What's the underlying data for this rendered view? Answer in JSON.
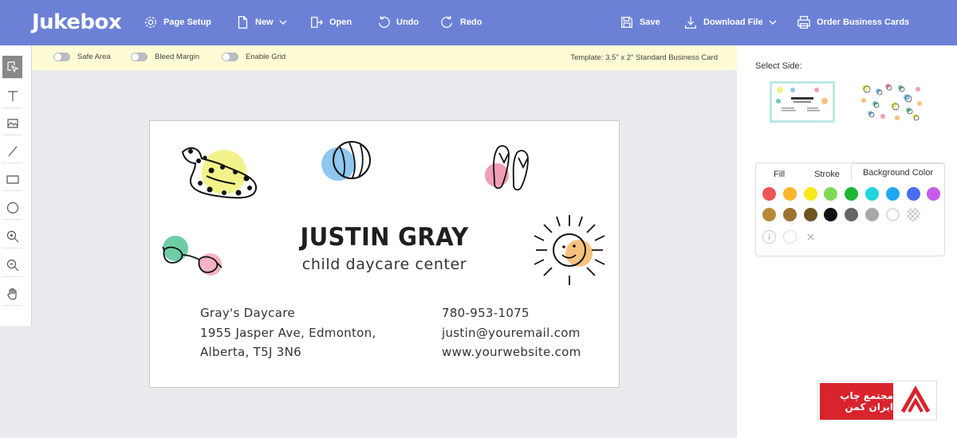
{
  "app": {
    "logo": "Jukebox"
  },
  "toolbar": {
    "page_setup": "Page Setup",
    "new": "New",
    "open": "Open",
    "undo": "Undo",
    "redo": "Redo",
    "save": "Save",
    "download": "Download File",
    "order": "Order Business Cards"
  },
  "subbar": {
    "safe_area": "Safe Area",
    "bleed_margin": "Bleed Margin",
    "enable_grid": "Enable Grid",
    "template": "Template: 3.5\" x 2\" Standard Business Card"
  },
  "tools": [
    "select-tool",
    "text-tool",
    "image-tool",
    "line-tool",
    "rectangle-tool",
    "ellipse-tool",
    "zoom-in-tool",
    "zoom-out-tool",
    "pan-tool"
  ],
  "card": {
    "name": "JUSTIN GRAY",
    "tagline": "child daycare center",
    "address": [
      "Gray's Daycare",
      "1955 Jasper Ave, Edmonton,",
      "Alberta, T5J 3N6"
    ],
    "contact": [
      "780-953-1075",
      "justin@youremail.com",
      "www.yourwebsite.com"
    ]
  },
  "right_panel": {
    "select_side": "Select Side:",
    "tabs": [
      "Fill",
      "Stroke",
      "Background Color"
    ],
    "active_tab": "Background Color",
    "swatches_row1": [
      "#f05454",
      "#f7b52b",
      "#f8e71c",
      "#7ed957",
      "#1db535",
      "#21d4e0",
      "#1fa7f0",
      "#4a6cf0",
      "#c45ce8"
    ],
    "swatches_row2": [
      "#b88a3a",
      "#9b7330",
      "#6e5522",
      "#111111",
      "#666666",
      "#a8a8a8",
      "#ffffff",
      "transparent"
    ]
  },
  "watermark": {
    "text": "مجتمع چاپ ایران کمن"
  }
}
